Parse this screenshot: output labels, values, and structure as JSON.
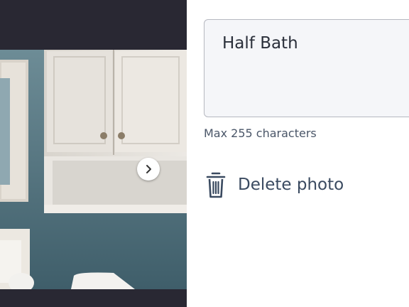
{
  "gallery": {
    "next_icon": "chevron-right-icon"
  },
  "caption": {
    "value": "Half Bath",
    "helper": "Max 255 characters"
  },
  "actions": {
    "delete_label": "Delete photo",
    "delete_icon": "trash-icon",
    "accent_color": "#3a4a60"
  }
}
